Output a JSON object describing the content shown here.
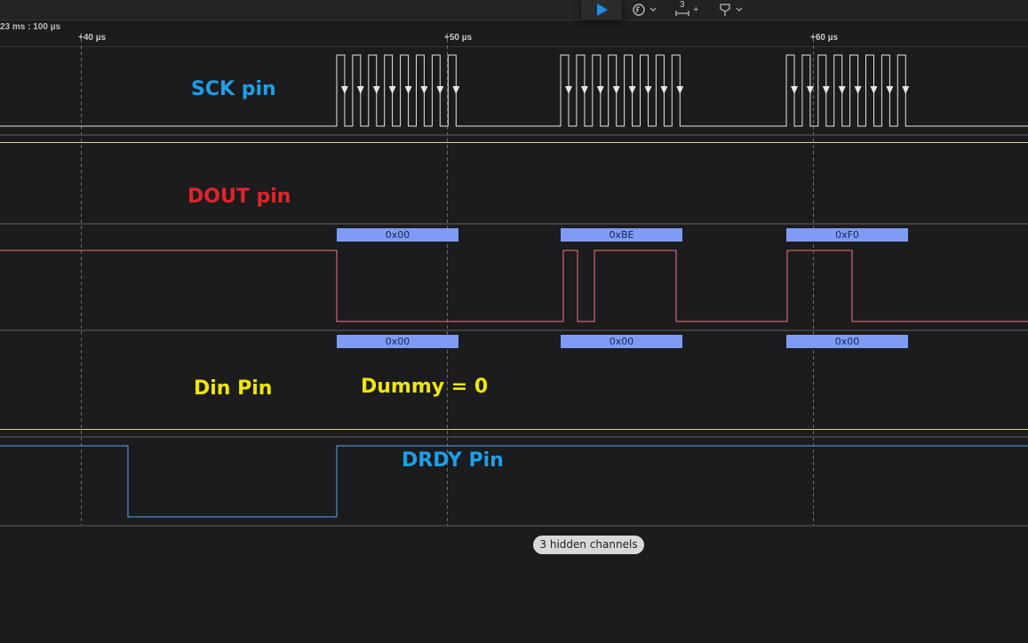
{
  "toolbar": {
    "play_icon": "play-icon",
    "trigger_icon": "trigger-icon",
    "measure_badge": "3",
    "measure_plus": "+",
    "marker_icon": "marker-icon"
  },
  "ruler": {
    "origin_label": "23 ms : 100 µs",
    "ticks": [
      "+40 µs",
      "+50 µs",
      "+60 µs"
    ]
  },
  "channels": {
    "sck": {
      "label": "SCK pin",
      "color": "#1e9fe8"
    },
    "dout": {
      "label": "DOUT pin",
      "color": "#e0242b",
      "trace_color": "#f08080"
    },
    "din": {
      "label": "Din Pin",
      "color": "#f0e60a",
      "annotation": "Dummy = 0"
    },
    "drdy": {
      "label": "DRDY Pin",
      "color": "#1e9fe8",
      "trace_color": "#5aa8f0"
    }
  },
  "decoded": {
    "dout_bytes": [
      "0x00",
      "0xBE",
      "0xF0"
    ],
    "din_bytes": [
      "0x00",
      "0x00",
      "0x00"
    ]
  },
  "footer": {
    "hidden_channels": "3 hidden channels"
  }
}
